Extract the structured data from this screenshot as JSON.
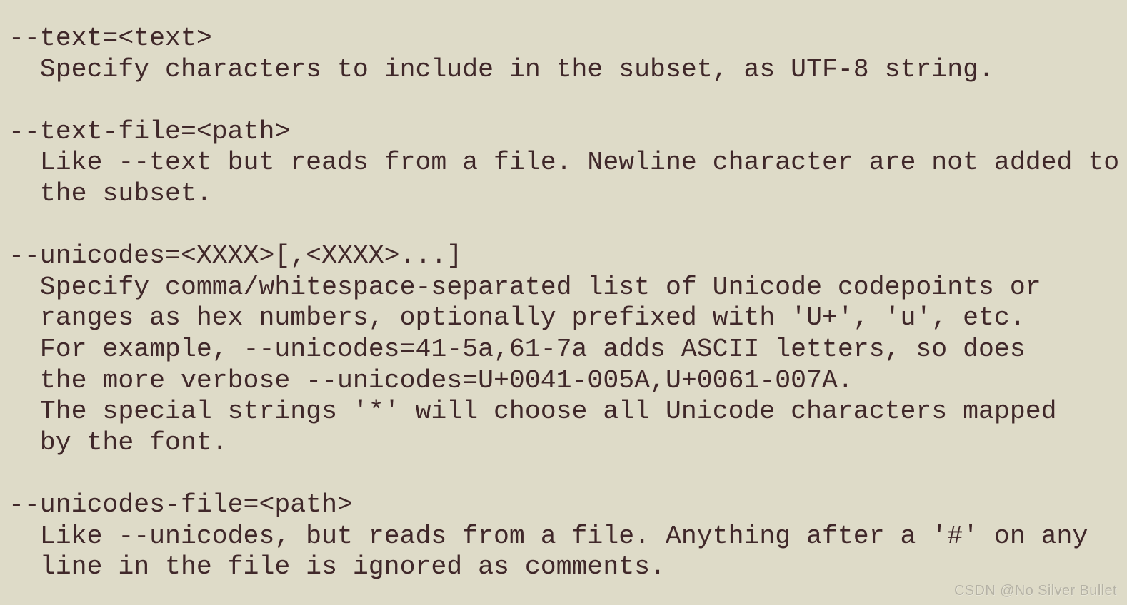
{
  "theme": {
    "background_color": "#dedbc8",
    "text_color": "#40282a",
    "watermark_color": "#b5b2a5"
  },
  "document": {
    "kind": "terminal-help-text",
    "lines": [
      "--text=<text>",
      "  Specify characters to include in the subset, as UTF-8 string.",
      "",
      "--text-file=<path>",
      "  Like --text but reads from a file. Newline character are not added to",
      "  the subset.",
      "",
      "--unicodes=<XXXX>[,<XXXX>...]",
      "  Specify comma/whitespace-separated list of Unicode codepoints or",
      "  ranges as hex numbers, optionally prefixed with 'U+', 'u', etc.",
      "  For example, --unicodes=41-5a,61-7a adds ASCII letters, so does",
      "  the more verbose --unicodes=U+0041-005A,U+0061-007A.",
      "  The special strings '*' will choose all Unicode characters mapped",
      "  by the font.",
      "",
      "--unicodes-file=<path>",
      "  Like --unicodes, but reads from a file. Anything after a '#' on any",
      "  line in the file is ignored as comments."
    ],
    "options": [
      {
        "flag": "--text=<text>",
        "description_lines": [
          "Specify characters to include in the subset, as UTF-8 string."
        ]
      },
      {
        "flag": "--text-file=<path>",
        "description_lines": [
          "Like --text but reads from a file. Newline character are not added to",
          "the subset."
        ]
      },
      {
        "flag": "--unicodes=<XXXX>[,<XXXX>...]",
        "description_lines": [
          "Specify comma/whitespace-separated list of Unicode codepoints or",
          "ranges as hex numbers, optionally prefixed with 'U+', 'u', etc.",
          "For example, --unicodes=41-5a,61-7a adds ASCII letters, so does",
          "the more verbose --unicodes=U+0041-005A,U+0061-007A.",
          "The special strings '*' will choose all Unicode characters mapped",
          "by the font."
        ]
      },
      {
        "flag": "--unicodes-file=<path>",
        "description_lines": [
          "Like --unicodes, but reads from a file. Anything after a '#' on any",
          "line in the file is ignored as comments."
        ]
      }
    ]
  },
  "watermark": {
    "text": "CSDN @No Silver Bullet"
  }
}
